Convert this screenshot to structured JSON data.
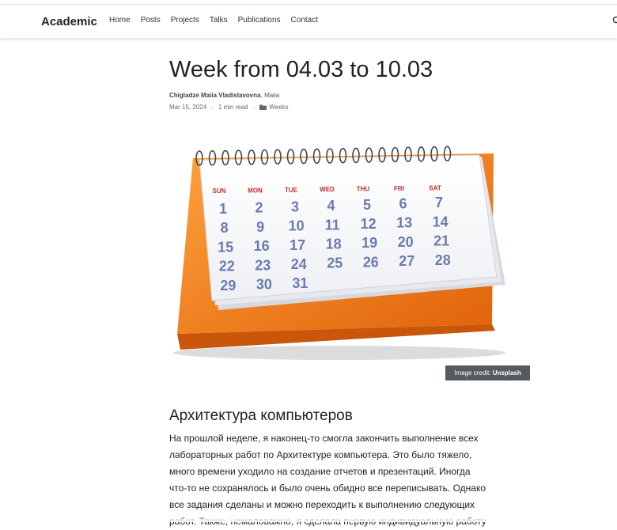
{
  "site": {
    "brand": "Academic"
  },
  "nav": {
    "items": [
      "Home",
      "Posts",
      "Projects",
      "Talks",
      "Publications",
      "Contact"
    ]
  },
  "article": {
    "title": "Week from 04.03 to 10.03",
    "author_primary": "Chigladze Maiia Vladislavovna",
    "author_separator": ",",
    "author_secondary": "Maiia",
    "date": "Mar 15, 2024",
    "reading_time": "1 min read",
    "category": "Weeks",
    "image_credit_prefix": "Image credit:",
    "image_credit_source": "Unsplash",
    "calendar": {
      "days": [
        "SUN",
        "MON",
        "TUE",
        "WED",
        "THU",
        "FRI",
        "SAT"
      ],
      "dates": [
        "1",
        "2",
        "3",
        "4",
        "5",
        "6",
        "7",
        "8",
        "9",
        "10",
        "11",
        "12",
        "13",
        "14",
        "15",
        "16",
        "17",
        "18",
        "19",
        "20",
        "21",
        "22",
        "23",
        "24",
        "25",
        "26",
        "27",
        "28",
        "29",
        "30",
        "31"
      ]
    },
    "section_heading": "Архитектура компьютеров",
    "body_lines": [
      "На прошлой неделе, я наконец-то смогла закончить выполнение всех",
      "лабораторных работ по Архитектуре компьютера. Это было тяжело,",
      "много времени уходило на создание отчетов и презентаций. Иногда",
      "что-то не сохранялось и было очень обидно все переписывать. Однако",
      "все задания сделаны и можно переходить к выполнению следующих",
      "работ. Также, немаловажно, я сделала первую индивидуальную работу"
    ]
  },
  "colors": {
    "calendar_orange": "#f07d1a",
    "calendar_text": "#6a7bb0",
    "day_label": "#c62b2b"
  },
  "icons": {
    "search": "search-icon",
    "category": "folder-icon"
  }
}
